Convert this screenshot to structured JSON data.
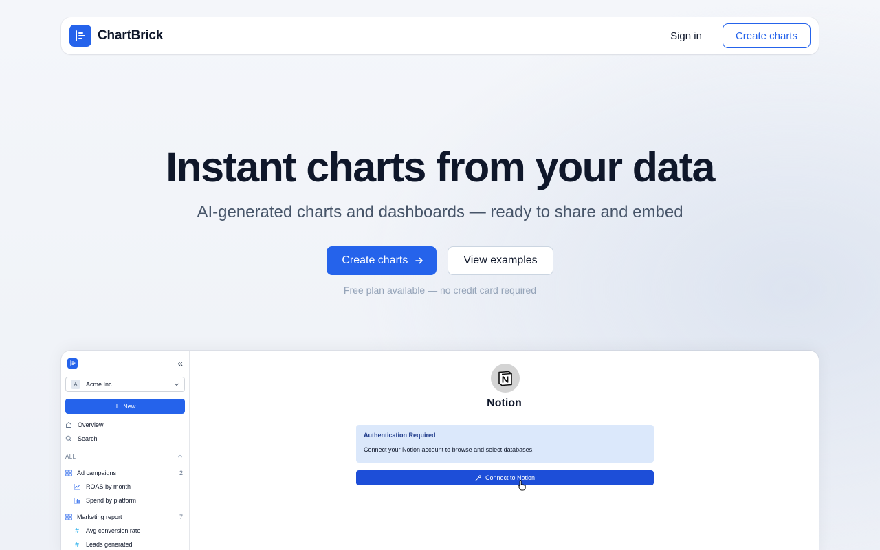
{
  "nav": {
    "brand": "ChartBrick",
    "sign_in": "Sign in",
    "cta": "Create charts"
  },
  "hero": {
    "title": "Instant charts from your data",
    "subtitle": "AI-generated charts and dashboards — ready to share and embed",
    "primary_button": "Create charts",
    "secondary_button": "View examples",
    "note": "Free plan available — no credit card required"
  },
  "preview": {
    "sidebar": {
      "workspace_initial": "A",
      "workspace_name": "Acme Inc",
      "new_button": "New",
      "links": [
        {
          "label": "Overview",
          "icon": "home-icon"
        },
        {
          "label": "Search",
          "icon": "search-icon"
        }
      ],
      "section_label": "ALL",
      "groups": [
        {
          "label": "Ad campaigns",
          "count": "2",
          "children": [
            {
              "label": "ROAS by month",
              "icon": "line-chart-icon"
            },
            {
              "label": "Spend by platform",
              "icon": "bar-chart-icon"
            }
          ]
        },
        {
          "label": "Marketing report",
          "count": "7",
          "children": [
            {
              "label": "Avg conversion rate",
              "icon": "hash-icon"
            },
            {
              "label": "Leads generated",
              "icon": "hash-icon"
            }
          ]
        }
      ]
    },
    "main": {
      "integration_name": "Notion",
      "auth_title": "Authentication Required",
      "auth_text": "Connect your Notion account to browse and select databases.",
      "connect_button": "Connect to Notion"
    }
  },
  "colors": {
    "brand": "#2563eb",
    "connect": "#1d4ed8",
    "auth_bg": "#dbe8fb"
  }
}
